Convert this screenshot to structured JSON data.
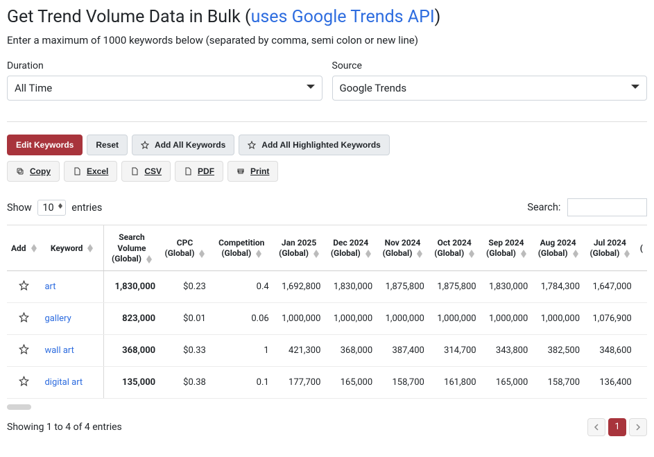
{
  "title_main": "Get Trend Volume Data in Bulk ",
  "title_link": "uses Google Trends API",
  "subtitle": "Enter a maximum of 1000 keywords below (separated by comma, semi colon or new line)",
  "duration": {
    "label": "Duration",
    "value": "All Time"
  },
  "source": {
    "label": "Source",
    "value": "Google Trends"
  },
  "toolbar": {
    "edit": "Edit Keywords",
    "reset": "Reset",
    "add_all": "Add All Keywords",
    "add_all_hl": "Add All Highlighted Keywords",
    "copy": "Copy",
    "excel": "Excel",
    "csv": "CSV",
    "pdf": "PDF",
    "print": "Print"
  },
  "entries": {
    "show": "Show",
    "value": "10",
    "suffix": "entries"
  },
  "search": {
    "label": "Search:"
  },
  "columns": [
    "Add",
    "Keyword",
    "Search Volume (Global)",
    "CPC (Global)",
    "Competition (Global)",
    "Jan 2025 (Global)",
    "Dec 2024 (Global)",
    "Nov 2024 (Global)",
    "Oct 2024 (Global)",
    "Sep 2024 (Global)",
    "Aug 2024 (Global)",
    "Jul 2024 (Global)"
  ],
  "rows": [
    {
      "keyword": "art",
      "vol": "1,830,000",
      "cpc": "$0.23",
      "comp": "0.4",
      "m": [
        "1,692,800",
        "1,830,000",
        "1,875,800",
        "1,875,800",
        "1,830,000",
        "1,784,300",
        "1,647,000"
      ]
    },
    {
      "keyword": "gallery",
      "vol": "823,000",
      "cpc": "$0.01",
      "comp": "0.06",
      "m": [
        "1,000,000",
        "1,000,000",
        "1,000,000",
        "1,000,000",
        "1,000,000",
        "1,000,000",
        "1,076,900"
      ]
    },
    {
      "keyword": "wall art",
      "vol": "368,000",
      "cpc": "$0.33",
      "comp": "1",
      "m": [
        "421,300",
        "368,000",
        "387,400",
        "314,700",
        "343,800",
        "382,500",
        "348,600"
      ]
    },
    {
      "keyword": "digital art",
      "vol": "135,000",
      "cpc": "$0.38",
      "comp": "0.1",
      "m": [
        "177,700",
        "165,000",
        "158,700",
        "161,800",
        "165,000",
        "158,700",
        "136,400"
      ]
    }
  ],
  "info": "Showing 1 to 4 of 4 entries",
  "pager": {
    "current": "1"
  },
  "extra_col_indicator": "("
}
